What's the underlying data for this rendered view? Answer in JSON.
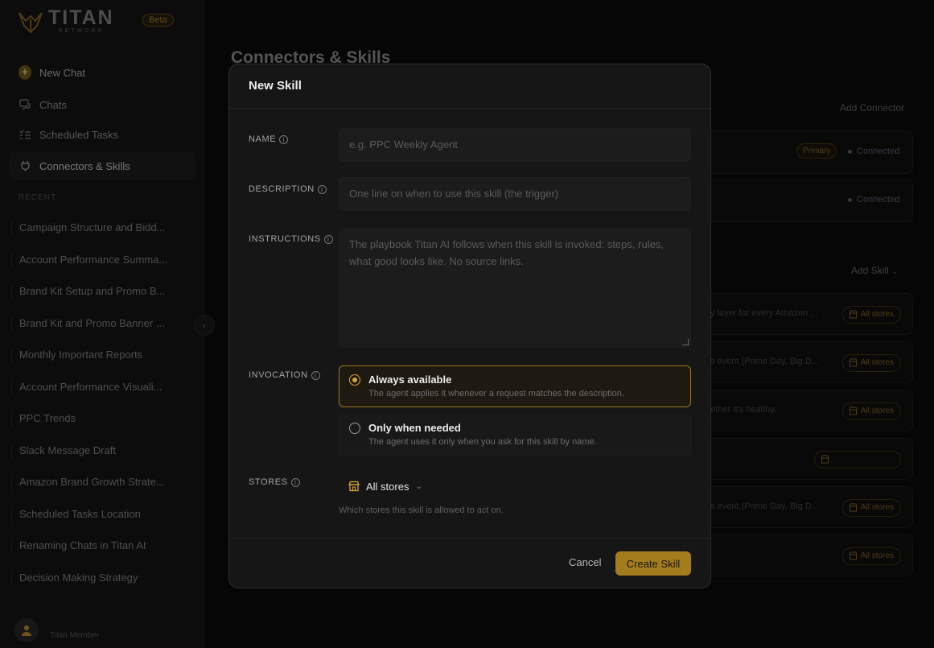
{
  "brand": {
    "name": "TITAN",
    "sub": "NETWORK",
    "badge": "Beta"
  },
  "sidebar": {
    "new_chat": "New Chat",
    "items": [
      {
        "label": "Chats",
        "icon": "chat-icon"
      },
      {
        "label": "Scheduled Tasks",
        "icon": "task-list-icon"
      },
      {
        "label": "Connectors & Skills",
        "icon": "plug-icon"
      }
    ],
    "recent_label": "RECENT",
    "recent": [
      "Campaign Structure and Bidd...",
      "Account Performance Summa...",
      "Brand Kit Setup and Promo B...",
      "Brand Kit and Promo Banner ...",
      "Monthly Important Reports",
      "Account Performance Visuali...",
      "PPC Trends",
      "Slack Message Draft",
      "Amazon Brand Growth Strate...",
      "Scheduled Tasks Location",
      "Renaming Chats in Titan AI",
      "Decision Making Strategy"
    ],
    "member": "Titan Member"
  },
  "main": {
    "title": "Connectors & Skills",
    "add_connector": "Add Connector",
    "add_skill": "Add Skill",
    "primary": "Primary",
    "connected": "Connected",
    "skill_rows": [
      {
        "text": "y layer for every Amazon ...",
        "stores": "All stores"
      },
      {
        "text": "s event (Prime Day, Big D...",
        "stores": "All stores"
      },
      {
        "text": "ether it's healthy.",
        "stores": "All stores"
      },
      {
        "text": "",
        "stores": ""
      },
      {
        "text": "s event (Prime Day, Big D...",
        "stores": "All stores"
      },
      {
        "text": "",
        "stores": "All stores"
      }
    ]
  },
  "modal": {
    "title": "New Skill",
    "name_label": "NAME",
    "name_placeholder": "e.g. PPC Weekly Agent",
    "description_label": "DESCRIPTION",
    "description_placeholder": "One line on when to use this skill (the trigger)",
    "instructions_label": "INSTRUCTIONS",
    "instructions_placeholder": "The playbook Titan AI follows when this skill is invoked: steps, rules, what good looks like. No source links.",
    "invocation_label": "INVOCATION",
    "options": [
      {
        "title": "Always available",
        "desc": "The agent applies it whenever a request matches the description.",
        "selected": true
      },
      {
        "title": "Only when needed",
        "desc": "The agent uses it only when you ask for this skill by name.",
        "selected": false
      }
    ],
    "stores_label": "STORES",
    "stores_value": "All stores",
    "stores_hint": "Which stores this skill is allowed to act on.",
    "cancel": "Cancel",
    "create": "Create Skill"
  },
  "colors": {
    "accent": "#a37c1d",
    "accent_light": "#d7a63a",
    "background": "#0b0b0b"
  }
}
